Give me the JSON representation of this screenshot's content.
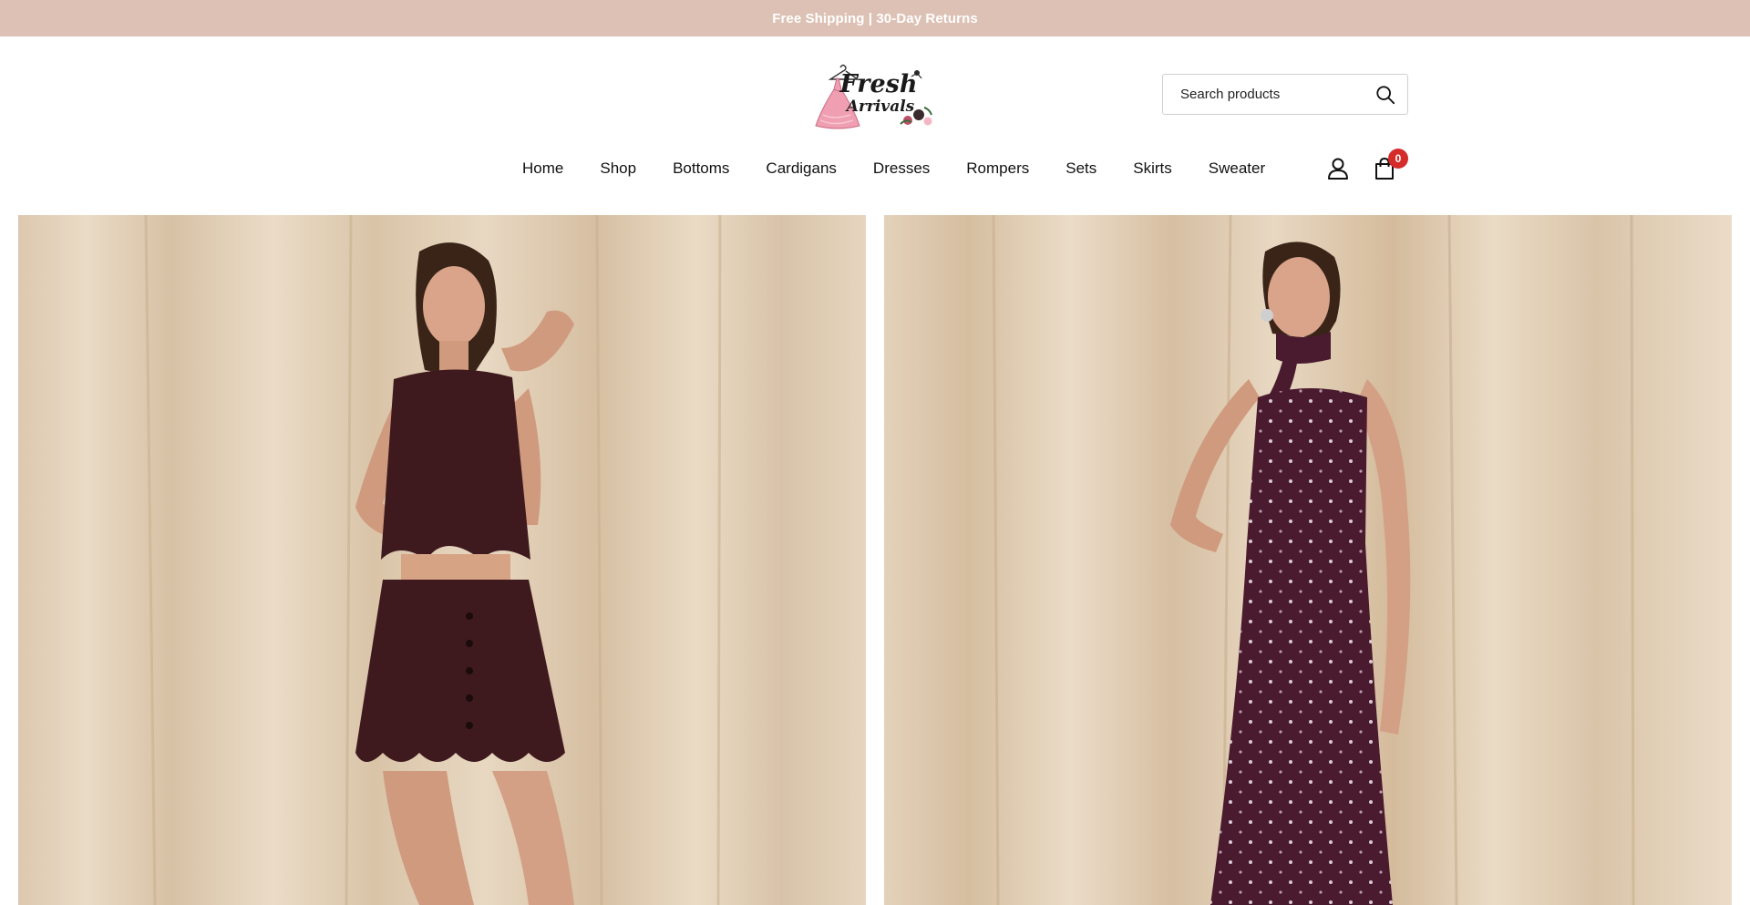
{
  "announcement": {
    "text": "Free Shipping | 30-Day Returns"
  },
  "brand": {
    "logo_line1": "Fresh",
    "logo_line2": "Arrivals",
    "logo_alt": "Fresh Arrivals"
  },
  "search": {
    "placeholder": "Search products",
    "value": ""
  },
  "nav": {
    "items": [
      {
        "label": "Home"
      },
      {
        "label": "Shop"
      },
      {
        "label": "Bottoms"
      },
      {
        "label": "Cardigans"
      },
      {
        "label": "Dresses"
      },
      {
        "label": "Rompers"
      },
      {
        "label": "Sets"
      },
      {
        "label": "Skirts"
      },
      {
        "label": "Sweater"
      }
    ]
  },
  "header_icons": {
    "account": "account-icon",
    "cart": "cart-icon"
  },
  "cart": {
    "count": "0"
  },
  "colors": {
    "announcement_bg": "#dcc1b4",
    "badge": "#d52b2b",
    "curtain": "#e3d2bd",
    "set_outfit": "#3e1a1e",
    "dress": "#4a1a2e"
  },
  "hero": {
    "images": [
      {
        "description_icon": "model-in-top-and-skirt-set-image"
      },
      {
        "description_icon": "model-in-sequin-slip-dress-image"
      }
    ]
  }
}
